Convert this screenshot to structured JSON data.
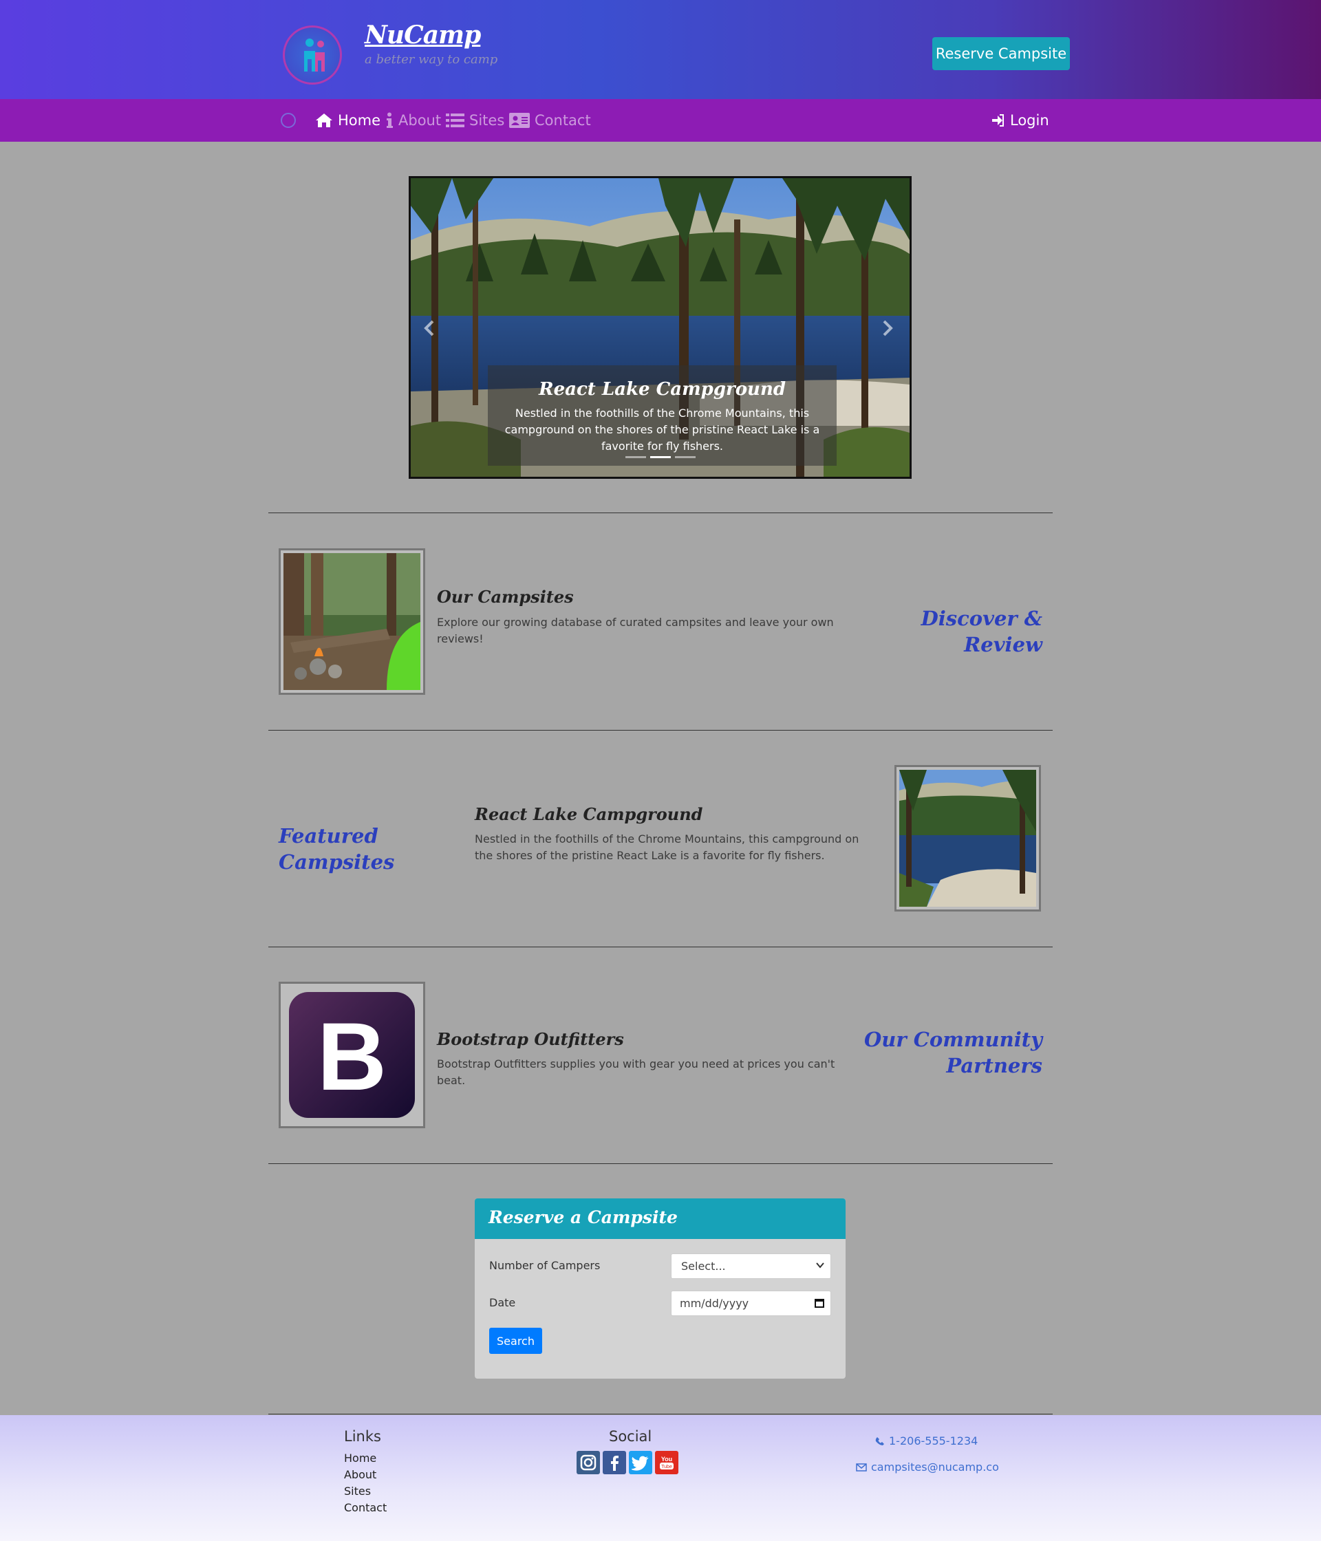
{
  "brand": {
    "title": "NuCamp",
    "subtitle": "a better way to camp"
  },
  "header": {
    "reserve_label": "Reserve Campsite"
  },
  "nav": {
    "items": [
      {
        "label": "Home",
        "icon": "home-icon",
        "active": true
      },
      {
        "label": "About",
        "icon": "info-icon",
        "active": false
      },
      {
        "label": "Sites",
        "icon": "list-icon",
        "active": false
      },
      {
        "label": "Contact",
        "icon": "address-card-icon",
        "active": false
      }
    ],
    "login_label": "Login"
  },
  "carousel": {
    "title": "React Lake Campground",
    "text": "Nestled in the foothills of the Chrome Mountains, this campground on the shores of the pristine React Lake is a favorite for fly fishers.",
    "active_slide": 2,
    "slide_count": 3
  },
  "sections": {
    "campsites": {
      "title": "Our Campsites",
      "text": "Explore our growing database of curated campsites and leave your own reviews!",
      "label": "Discover & Review"
    },
    "featured": {
      "label": "Featured Campsites",
      "title": "React Lake Campground",
      "text": "Nestled in the foothills of the Chrome Mountains, this campground on the shores of the pristine React Lake is a favorite for fly fishers."
    },
    "partners": {
      "title": "Bootstrap Outfitters",
      "text": "Bootstrap Outfitters supplies you with gear you need at prices you can't beat.",
      "label": "Our Community Partners",
      "logo_letter": "B"
    }
  },
  "reserve_form": {
    "title": "Reserve a Campsite",
    "campers_label": "Number of Campers",
    "campers_value": "Select...",
    "date_label": "Date",
    "date_placeholder": "mm/dd/yyyy",
    "search_label": "Search"
  },
  "footer": {
    "links_heading": "Links",
    "links": [
      "Home",
      "About",
      "Sites",
      "Contact"
    ],
    "social_heading": "Social",
    "social": [
      "instagram-icon",
      "facebook-icon",
      "twitter-icon",
      "youtube-icon"
    ],
    "phone": "1-206-555-1234",
    "email": "campsites@nucamp.co"
  },
  "colors": {
    "accent": "#17a2b8",
    "nav": "#8d1cb4",
    "label": "#2b3fbd",
    "primary": "#007bff"
  }
}
